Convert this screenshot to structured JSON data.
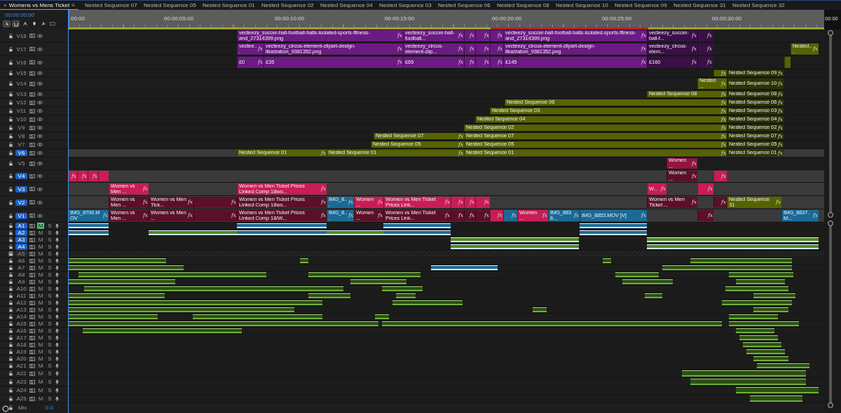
{
  "tabs": [
    {
      "label": "Womens vs Mens Ticket",
      "selected": true,
      "close": "×",
      "menu": "≡"
    },
    {
      "label": "Nested Sequence 07",
      "selected": false
    },
    {
      "label": "Nested Sequence 05",
      "selected": false
    },
    {
      "label": "Nested Sequence 01",
      "selected": false
    },
    {
      "label": "Nested Sequence 02",
      "selected": false
    },
    {
      "label": "Nested Sequence 04",
      "selected": false
    },
    {
      "label": "Nested Sequence 03",
      "selected": false
    },
    {
      "label": "Nested Sequence 06",
      "selected": false
    },
    {
      "label": "Nested Sequence 08",
      "selected": false
    },
    {
      "label": "Nested Sequence 10",
      "selected": false
    },
    {
      "label": "Nested Sequence 09",
      "selected": false
    },
    {
      "label": "Nested Sequence 31",
      "selected": false
    },
    {
      "label": "Nested Sequence 32",
      "selected": false
    }
  ],
  "timecode": "00:00:00:00",
  "tools": [
    {
      "on": true
    },
    {
      "on": true
    },
    {
      "on": false
    },
    {
      "on": false
    },
    {
      "on": false
    },
    {
      "on": false
    }
  ],
  "ruler": [
    "00:00",
    "00:00:05:00",
    "00:00:10:00",
    "00:00:15:00",
    "00:00:20:00",
    "00:00:25:00",
    "00:00:30:00",
    "00:00"
  ],
  "video_tracks": [
    {
      "name": "V18",
      "targeted": false,
      "clips": [
        {
          "label": "vecteezy_soccer-ball-football-balls-isolated-sports-fitness-and_27314399.png",
          "color": "#6c1a84",
          "badge": "fx"
        },
        {
          "label": "vecteezy_soccer-ball-football...",
          "color": "#6c1a84",
          "badge": "fx"
        },
        {
          "color": "#6c1a84",
          "badge": "fx"
        },
        {
          "color": "#6c1a84",
          "badge": "fx"
        },
        {
          "color": "#6c1a84",
          "badge": "fx"
        },
        {
          "label": "vecteezy_soccer-ball-football-balls-isolated-sports-fitness-and_27314399.png",
          "color": "#6c1a84",
          "badge": "fx"
        },
        {
          "label": "vecteezy_soccer-ball-f...",
          "color": "#3b0f47",
          "badge": "fx"
        },
        {
          "color": "#3b0f47",
          "badge": "fx"
        }
      ]
    },
    {
      "name": "V17",
      "targeted": false,
      "clips": [
        {
          "label": "vectee...",
          "color": "#6c1a84",
          "badge": "fx"
        },
        {
          "label": "vecteezy_circus-element-clipart-design-illustration_9381352.png",
          "color": "#6c1a84",
          "badge": "fx"
        },
        {
          "label": "vecteezy_circus-element-clip...",
          "color": "#6c1a84",
          "badge": "fx"
        },
        {
          "color": "#6c1a84",
          "badge": "fx"
        },
        {
          "color": "#6c1a84",
          "badge": "fx"
        },
        {
          "color": "#6c1a84",
          "badge": "fx"
        },
        {
          "label": "vecteezy_circus-element-clipart-design-illustration_9381352.png",
          "color": "#6c1a84",
          "badge": "fx"
        },
        {
          "label": "vecteezy_circus-elem...",
          "color": "#3b0f47",
          "badge": "fx"
        },
        {
          "color": "#3b0f47",
          "badge": "fx"
        },
        {
          "label": "Nested...",
          "color": "#566300",
          "badge": "fx"
        }
      ]
    },
    {
      "name": "V16",
      "targeted": false,
      "clips": [
        {
          "label": "£0",
          "color": "#6c1a84",
          "badge": "fx"
        },
        {
          "label": "£35",
          "color": "#6c1a84",
          "badge": "fx"
        },
        {
          "label": "£65",
          "color": "#6c1a84",
          "badge": "fx"
        },
        {
          "color": "#6c1a84",
          "badge": "fx"
        },
        {
          "color": "#6c1a84",
          "badge": "fx"
        },
        {
          "color": "#6c1a84",
          "badge": "fx"
        },
        {
          "label": "£145",
          "color": "#6c1a84",
          "badge": "fx"
        },
        {
          "label": "£160",
          "color": "#3b0f47",
          "badge": "fx"
        },
        {
          "color": "#3b0f47",
          "badge": "fx"
        },
        {
          "color": "#566300"
        }
      ]
    },
    {
      "name": "V15",
      "targeted": false,
      "clips": [
        {
          "color": "#566300",
          "badge": "fx"
        },
        {
          "label": "Nested Sequence 09",
          "color": "#2d3300",
          "badge": "fx"
        }
      ]
    },
    {
      "name": "V14",
      "targeted": false,
      "clips": [
        {
          "label": "Nested ...",
          "color": "#566300",
          "badge": "fx"
        },
        {
          "label": "Nested Sequence 10",
          "color": "#2d3300",
          "badge": "fx"
        }
      ]
    },
    {
      "name": "V13",
      "targeted": false,
      "clips": [
        {
          "label": "Nested Sequence 08",
          "color": "#566300",
          "badge": "fx"
        },
        {
          "label": "Nested Sequence 08",
          "color": "#2d3300",
          "badge": "fx"
        }
      ]
    },
    {
      "name": "V12",
      "targeted": false,
      "clips": [
        {
          "label": "Nested Sequence 06",
          "color": "#566300",
          "badge": "fx"
        },
        {
          "label": "Nested Sequence 06",
          "color": "#2d3300",
          "badge": "fx"
        }
      ]
    },
    {
      "name": "V11",
      "targeted": false,
      "clips": [
        {
          "label": "Nested Sequence 03",
          "color": "#566300",
          "badge": "fx"
        },
        {
          "label": "Nested Sequence 03",
          "color": "#2d3300",
          "badge": "fx"
        }
      ]
    },
    {
      "name": "V10",
      "targeted": false,
      "clips": [
        {
          "label": "Nested Sequence 04",
          "color": "#566300",
          "badge": "fx"
        },
        {
          "label": "Nested Sequence 04",
          "color": "#2d3300",
          "badge": "fx"
        }
      ]
    },
    {
      "name": "V9",
      "targeted": false,
      "clips": [
        {
          "label": "Nested Sequence 02",
          "color": "#566300",
          "badge": "fx"
        },
        {
          "label": "Nested Sequence 02",
          "color": "#2d3300",
          "badge": "fx"
        }
      ]
    },
    {
      "name": "V8",
      "targeted": false,
      "clips": [
        {
          "label": "Nested Sequence 07",
          "color": "#566300",
          "badge": "fx"
        },
        {
          "label": "Nested Sequence 07",
          "color": "#566300",
          "badge": "fx"
        },
        {
          "label": "Nested Sequence 07",
          "color": "#2d3300",
          "badge": "fx"
        }
      ]
    },
    {
      "name": "V7",
      "targeted": false,
      "clips": [
        {
          "label": "Nested Sequence 05",
          "color": "#566300",
          "badge": "fx"
        },
        {
          "label": "Nested Sequence 05",
          "color": "#566300",
          "badge": "fx"
        },
        {
          "label": "Nested Sequence 05",
          "color": "#2d3300",
          "badge": "fx"
        }
      ]
    },
    {
      "name": "V6",
      "targeted": true,
      "clips": [
        {
          "label": "Nested Sequence 01",
          "color": "#566300",
          "badge": "fx"
        },
        {
          "label": "Nested Sequence 01",
          "color": "#566300",
          "badge": "fx"
        },
        {
          "label": "Nested Sequence 01",
          "color": "#566300",
          "badge": "fx"
        },
        {
          "label": "Nested Sequence 01",
          "color": "#2d3300",
          "badge": "fx"
        }
      ]
    },
    {
      "name": "V5",
      "targeted": false,
      "clips": [
        {
          "label": "Women ...",
          "color": "#951340",
          "badge": "fx"
        }
      ]
    },
    {
      "name": "V4",
      "targeted": true,
      "clips": [
        {
          "color": "#c81d55",
          "badge": "fx"
        },
        {
          "color": "#c81d55",
          "badge": "fx"
        },
        {
          "color": "#c81d55",
          "badge": "fx"
        },
        {
          "color": "#c81d55"
        },
        {
          "label": "Women ...",
          "color": "#5c1027",
          "badge": "fx"
        },
        {
          "color": "#c81d55",
          "badge": "fx"
        }
      ]
    },
    {
      "name": "V3",
      "targeted": true,
      "clips": [
        {
          "label": "Women vs Men ...",
          "color": "#c81d55",
          "badge": "fx"
        },
        {
          "label": "Women vs Men Ticket Prices Linked Comp 18wo...",
          "color": "#c81d55",
          "badge": "fx"
        },
        {
          "label": "W...",
          "color": "#c81d55",
          "badge": "fx"
        },
        {
          "color": "#c81d55",
          "badge": "fx"
        }
      ]
    },
    {
      "name": "V2",
      "targeted": true,
      "clips": [
        {
          "label": "Women vs Men ...",
          "color": "#5c1027",
          "badge": "fx"
        },
        {
          "label": "Women vs Men Tick...",
          "color": "#5c1027",
          "badge": "fx"
        },
        {
          "color": "#5c1027",
          "badge": "fx"
        },
        {
          "label": "Women vs Men Ticket Prices Linked Comp 18wo...",
          "color": "#5c1027",
          "badge": "fx"
        },
        {
          "label": "IMG_8...",
          "color": "#1a6a96",
          "badge": "fx"
        },
        {
          "label": "Women ...",
          "color": "#c81d55",
          "badge": "fx"
        },
        {
          "label": "Women vs Men Ticket Prices Link...",
          "color": "#c81d55",
          "badge": "fx"
        },
        {
          "color": "#c81d55",
          "badge": "fx"
        },
        {
          "color": "#c81d55",
          "badge": "fx"
        },
        {
          "color": "#c81d55",
          "badge": "fx"
        },
        {
          "label": "Women vs Men Ticket ...",
          "color": "#5c1027",
          "badge": "fx"
        },
        {
          "color": "#5c1027",
          "badge": "fx"
        },
        {
          "label": "Nested Sequence 31",
          "color": "#566300",
          "badge": "fx"
        }
      ]
    },
    {
      "name": "V1",
      "targeted": true,
      "clips": [
        {
          "label": "IMG_8790.MOV",
          "color": "#1a6a96",
          "badge": "fx"
        },
        {
          "label": "Women vs Men ...",
          "color": "#5c1027",
          "badge": "fx"
        },
        {
          "label": "Women vs Men ...",
          "color": "#5c1027",
          "badge": "fx"
        },
        {
          "color": "#5c1027",
          "badge": "fx"
        },
        {
          "label": "Women vs Men Ticket Prices Linked Comp 18/W...",
          "color": "#5c1027",
          "badge": "fx"
        },
        {
          "label": "IMG_8...",
          "color": "#1a6a96",
          "badge": "fx"
        },
        {
          "label": "Women ...",
          "color": "#5c1027",
          "badge": "fx"
        },
        {
          "label": "Women vs Men Ticket Prices Link...",
          "color": "#5c1027",
          "badge": "fx"
        },
        {
          "color": "#5c1027",
          "badge": "fx"
        },
        {
          "color": "#5c1027",
          "badge": "fx"
        },
        {
          "color": "#5c1027",
          "badge": "fx"
        },
        {
          "color": "#c81d55",
          "badge": "fx"
        },
        {
          "color": "#1a6a96",
          "badge": "fx"
        },
        {
          "label": "Women ...",
          "color": "#c81d55",
          "badge": "fx"
        },
        {
          "label": "IMG_8836...",
          "color": "#1a6a96",
          "badge": "fx"
        },
        {
          "label": "IMG_8853.MOV [V]",
          "color": "#1a6a96",
          "badge": "fx"
        },
        {
          "color": "#5c1027",
          "badge": "fx"
        },
        {
          "label": "IMG_8837.M...",
          "color": "#1a6a96",
          "badge": "fx"
        }
      ]
    }
  ],
  "audio_tracks": [
    {
      "name": "A1",
      "targeted": true,
      "locked": false,
      "mute": "M",
      "muted": true,
      "solo": "S"
    },
    {
      "name": "A2",
      "targeted": true,
      "locked": false,
      "mute": "M",
      "muted": false,
      "solo": "S"
    },
    {
      "name": "A3",
      "targeted": true,
      "locked": false,
      "mute": "M",
      "muted": false,
      "solo": "S"
    },
    {
      "name": "A4",
      "targeted": true,
      "locked": false,
      "mute": "M",
      "muted": false,
      "solo": "S"
    },
    {
      "name": "A5",
      "targeted": false,
      "locked": true,
      "mute": "M",
      "muted": false,
      "solo": "S"
    },
    {
      "name": "A6",
      "targeted": false,
      "locked": false,
      "mute": "M",
      "muted": false,
      "solo": "S"
    },
    {
      "name": "A7",
      "targeted": false,
      "locked": false,
      "mute": "M",
      "muted": false,
      "solo": "S"
    },
    {
      "name": "A8",
      "targeted": false,
      "locked": false,
      "mute": "M",
      "muted": false,
      "solo": "S"
    },
    {
      "name": "A9",
      "targeted": false,
      "locked": false,
      "mute": "M",
      "muted": false,
      "solo": "S"
    },
    {
      "name": "A10",
      "targeted": false,
      "locked": false,
      "mute": "M",
      "muted": false,
      "solo": "S"
    },
    {
      "name": "A11",
      "targeted": false,
      "locked": false,
      "mute": "M",
      "muted": false,
      "solo": "S"
    },
    {
      "name": "A12",
      "targeted": false,
      "locked": false,
      "mute": "M",
      "muted": false,
      "solo": "S"
    },
    {
      "name": "A13",
      "targeted": false,
      "locked": false,
      "mute": "M",
      "muted": false,
      "solo": "S"
    },
    {
      "name": "A14",
      "targeted": false,
      "locked": false,
      "mute": "M",
      "muted": false,
      "solo": "S"
    },
    {
      "name": "A15",
      "targeted": false,
      "locked": false,
      "mute": "M",
      "muted": false,
      "solo": "S"
    },
    {
      "name": "A16",
      "targeted": false,
      "locked": false,
      "mute": "M",
      "muted": false,
      "solo": "S"
    },
    {
      "name": "A17",
      "targeted": false,
      "locked": false,
      "mute": "M",
      "muted": false,
      "solo": "S"
    },
    {
      "name": "A18",
      "targeted": false,
      "locked": false,
      "mute": "M",
      "muted": false,
      "solo": "S"
    },
    {
      "name": "A19",
      "targeted": false,
      "locked": false,
      "mute": "M",
      "muted": false,
      "solo": "S"
    },
    {
      "name": "A20",
      "targeted": false,
      "locked": false,
      "mute": "M",
      "muted": false,
      "solo": "S"
    },
    {
      "name": "A21",
      "targeted": false,
      "locked": false,
      "mute": "M",
      "muted": false,
      "solo": "S"
    },
    {
      "name": "A22",
      "targeted": false,
      "locked": false,
      "mute": "M",
      "muted": false,
      "solo": "S"
    },
    {
      "name": "A23",
      "targeted": false,
      "locked": false,
      "mute": "M",
      "muted": false,
      "solo": "S"
    },
    {
      "name": "A24",
      "targeted": false,
      "locked": false,
      "mute": "M",
      "muted": false,
      "solo": "S"
    },
    {
      "name": "A25",
      "targeted": false,
      "locked": false,
      "mute": "M",
      "muted": false,
      "solo": "S"
    }
  ],
  "mix": {
    "name": "Mix",
    "value": "0.0"
  }
}
